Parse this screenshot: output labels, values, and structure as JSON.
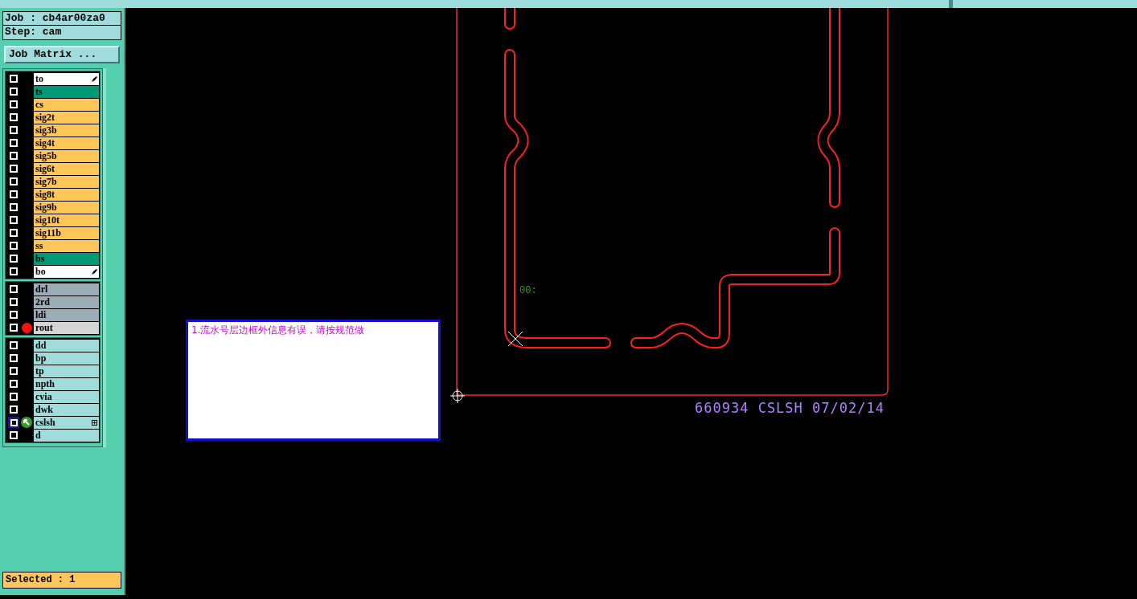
{
  "job": {
    "label": "Job : cb4ar00za0"
  },
  "step": {
    "label": "Step: cam"
  },
  "job_matrix_button": "Job Matrix ...",
  "layer_groups": [
    {
      "layers": [
        {
          "name": "to",
          "color": "#ffffff",
          "highlighted": false,
          "pen": true,
          "expandable": false,
          "displayed": false,
          "work": false
        },
        {
          "name": "ts",
          "color": "#009977",
          "highlighted": false,
          "pen": false,
          "expandable": false,
          "displayed": false,
          "work": false
        },
        {
          "name": "cs",
          "color": "#ffc65a",
          "highlighted": false,
          "pen": false,
          "expandable": false,
          "displayed": false,
          "work": false
        },
        {
          "name": "sig2t",
          "color": "#ffc65a",
          "highlighted": false,
          "pen": false,
          "expandable": false,
          "displayed": false,
          "work": false
        },
        {
          "name": "sig3b",
          "color": "#ffc65a",
          "highlighted": false,
          "pen": false,
          "expandable": false,
          "displayed": false,
          "work": false
        },
        {
          "name": "sig4t",
          "color": "#ffc65a",
          "highlighted": false,
          "pen": false,
          "expandable": false,
          "displayed": false,
          "work": false
        },
        {
          "name": "sig5b",
          "color": "#ffc65a",
          "highlighted": false,
          "pen": false,
          "expandable": false,
          "displayed": false,
          "work": false
        },
        {
          "name": "sig6t",
          "color": "#ffc65a",
          "highlighted": false,
          "pen": false,
          "expandable": false,
          "displayed": false,
          "work": false
        },
        {
          "name": "sig7b",
          "color": "#ffc65a",
          "highlighted": false,
          "pen": false,
          "expandable": false,
          "displayed": false,
          "work": false
        },
        {
          "name": "sig8t",
          "color": "#ffc65a",
          "highlighted": false,
          "pen": false,
          "expandable": false,
          "displayed": false,
          "work": false
        },
        {
          "name": "sig9b",
          "color": "#ffc65a",
          "highlighted": false,
          "pen": false,
          "expandable": false,
          "displayed": false,
          "work": false
        },
        {
          "name": "sig10t",
          "color": "#ffc65a",
          "highlighted": false,
          "pen": false,
          "expandable": false,
          "displayed": false,
          "work": false
        },
        {
          "name": "sig11b",
          "color": "#ffc65a",
          "highlighted": false,
          "pen": false,
          "expandable": false,
          "displayed": false,
          "work": false
        },
        {
          "name": "ss",
          "color": "#ffc65a",
          "highlighted": false,
          "pen": false,
          "expandable": false,
          "displayed": false,
          "work": false
        },
        {
          "name": "bs",
          "color": "#009977",
          "highlighted": false,
          "pen": false,
          "expandable": false,
          "displayed": false,
          "work": false
        },
        {
          "name": "bo",
          "color": "#ffffff",
          "highlighted": false,
          "pen": true,
          "expandable": false,
          "displayed": false,
          "work": false
        }
      ]
    },
    {
      "layers": [
        {
          "name": "drl",
          "color": "#9aacb6",
          "highlighted": false,
          "pen": false,
          "expandable": false,
          "displayed": false,
          "work": false
        },
        {
          "name": "2rd",
          "color": "#9aacb6",
          "highlighted": false,
          "pen": false,
          "expandable": false,
          "displayed": false,
          "work": false
        },
        {
          "name": "ldi",
          "color": "#9aacb6",
          "highlighted": false,
          "pen": false,
          "expandable": false,
          "displayed": false,
          "work": false
        },
        {
          "name": "rout",
          "color": "#d4d4d4",
          "highlighted": false,
          "pen": false,
          "expandable": false,
          "displayed": true,
          "work": false
        }
      ]
    },
    {
      "layers": [
        {
          "name": "dd",
          "color": "#a0dcdc",
          "highlighted": false,
          "pen": false,
          "expandable": false,
          "displayed": false,
          "work": false
        },
        {
          "name": "bp",
          "color": "#a0dcdc",
          "highlighted": false,
          "pen": false,
          "expandable": false,
          "displayed": false,
          "work": false
        },
        {
          "name": "tp",
          "color": "#a0dcdc",
          "highlighted": false,
          "pen": false,
          "expandable": false,
          "displayed": false,
          "work": false
        },
        {
          "name": "npth",
          "color": "#a0dcdc",
          "highlighted": false,
          "pen": false,
          "expandable": false,
          "displayed": false,
          "work": false
        },
        {
          "name": "cvia",
          "color": "#a0dcdc",
          "highlighted": false,
          "pen": false,
          "expandable": false,
          "displayed": false,
          "work": false
        },
        {
          "name": "dwk",
          "color": "#a0dcdc",
          "highlighted": false,
          "pen": false,
          "expandable": false,
          "displayed": false,
          "work": false
        },
        {
          "name": "cslsh",
          "color": "#a0dcdc",
          "highlighted": true,
          "pen": false,
          "expandable": true,
          "displayed": false,
          "work": true
        },
        {
          "name": "d",
          "color": "#a0dcdc",
          "highlighted": false,
          "pen": false,
          "expandable": false,
          "displayed": false,
          "work": false
        }
      ]
    }
  ],
  "status_bar": "Selected : 1",
  "canvas": {
    "small_label": "00:",
    "board_text": "660934 CSLSH 07/02/14"
  },
  "comment_box": {
    "text": "1.流水号层边框外信息有误，请按规范做"
  }
}
